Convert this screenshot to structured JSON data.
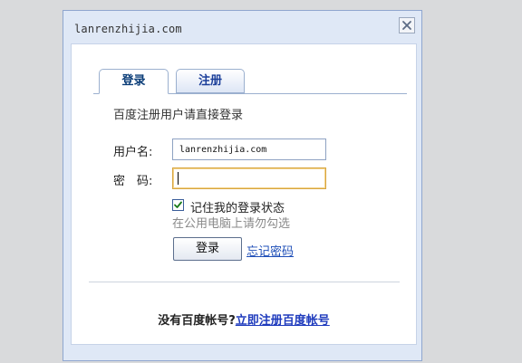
{
  "dialog": {
    "title": "lanrenzhijia.com",
    "close_label": "close"
  },
  "tabs": [
    {
      "label": "登录",
      "active": true
    },
    {
      "label": "注册",
      "active": false
    }
  ],
  "login_form": {
    "hint": "百度注册用户请直接登录",
    "username_label": "用户名:",
    "username_value": "lanrenzhijia.com",
    "password_label": "密　码:",
    "password_value": "",
    "remember_label": "记住我的登录状态",
    "remember_checked": true,
    "remember_tip": "在公用电脑上请勿勾选",
    "submit_label": "登录",
    "forgot_label": "忘记密码"
  },
  "footer": {
    "question": "没有百度帐号?",
    "register_link": "立即注册百度帐号"
  },
  "colors": {
    "accent": "#1f3bbd",
    "tab_text": "#0b3d78",
    "focus_border": "#d8a640"
  }
}
